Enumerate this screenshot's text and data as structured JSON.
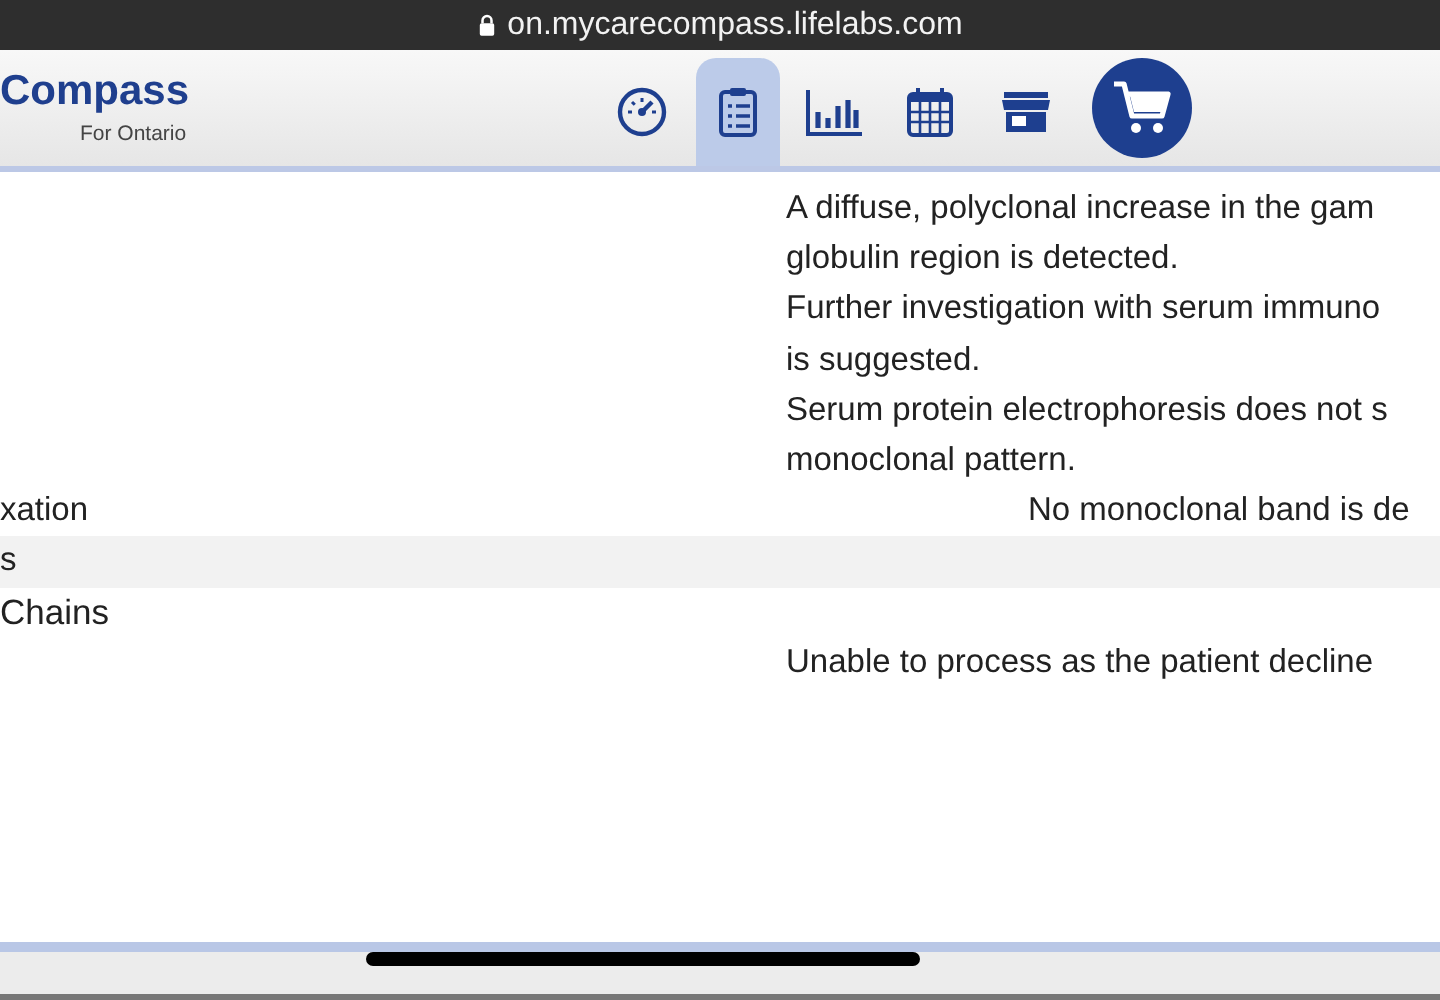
{
  "address_bar": {
    "url": "on.mycarecompass.lifelabs.com"
  },
  "header": {
    "logo": "Compass",
    "logo_subtitle": "For Ontario"
  },
  "nav": [
    {
      "kind": "gauge",
      "selected": false
    },
    {
      "kind": "clipboard",
      "selected": true
    },
    {
      "kind": "chart",
      "selected": false
    },
    {
      "kind": "calendar",
      "selected": false
    },
    {
      "kind": "store",
      "selected": false
    },
    {
      "kind": "cart",
      "selected": false
    }
  ],
  "rows": [
    {
      "kind": "result",
      "label": "",
      "value_lines": [
        "A diffuse, polyclonal increase in the gam",
        "globulin region is detected.",
        "Further investigation with serum immuno",
        "is suggested.",
        "Serum protein electrophoresis does not s",
        "monoclonal pattern."
      ]
    },
    {
      "kind": "result_centered",
      "label": "xation",
      "value_lines": [
        "No monoclonal band is de"
      ]
    },
    {
      "kind": "section",
      "label": "s",
      "value_lines": []
    },
    {
      "kind": "subsection",
      "label": "Chains",
      "value_lines": []
    },
    {
      "kind": "result",
      "label": "",
      "value_lines": [
        "Unable to process as the patient decline"
      ]
    }
  ]
}
